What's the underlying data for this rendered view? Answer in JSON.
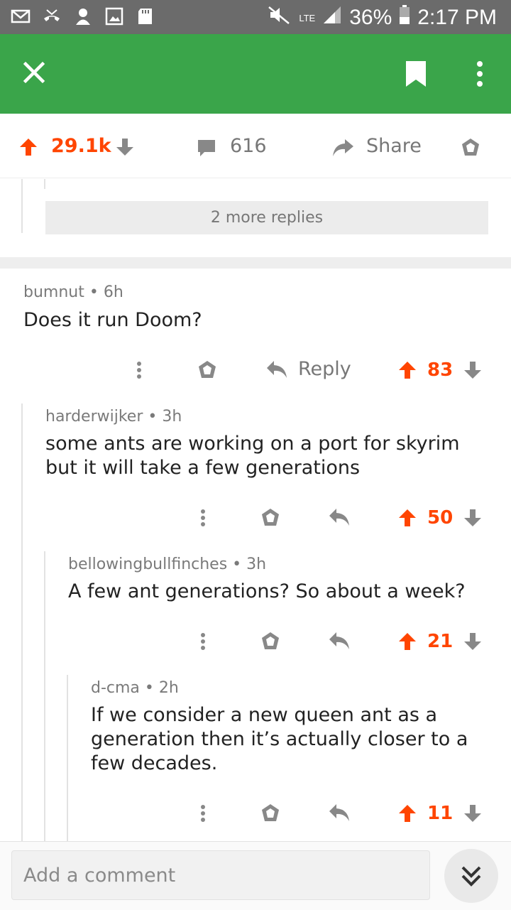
{
  "status_bar": {
    "lte": "LTE",
    "battery": "36%",
    "time": "2:17 PM"
  },
  "toolbar": {
    "bg_color": "#3aa54a",
    "close_icon": "close-icon",
    "bookmark_icon": "bookmark-icon",
    "more_icon": "more-vertical-icon"
  },
  "post_actions": {
    "score": "29.1k",
    "comments": "616",
    "share": "Share"
  },
  "more_replies": "2 more replies",
  "comments": [
    {
      "author": "bumnut",
      "age": "6h",
      "body": "Does it run Doom?",
      "reply_label": "Reply",
      "score": "83"
    },
    {
      "author": "harderwijker",
      "age": "3h",
      "body": "some ants are working on a port for skyrim but it will take a few generations",
      "score": "50"
    },
    {
      "author": "bellowingbullfinches",
      "age": "3h",
      "body": "A few ant generations? So about a week?",
      "score": "21"
    },
    {
      "author": "d-cma",
      "age": "2h",
      "body": "If we consider a new queen ant as a generation then it’s actually closer to a few decades.",
      "score": "11"
    }
  ],
  "composer": {
    "placeholder": "Add a comment"
  },
  "colors": {
    "upvote": "#ff4500",
    "muted": "#777777"
  }
}
